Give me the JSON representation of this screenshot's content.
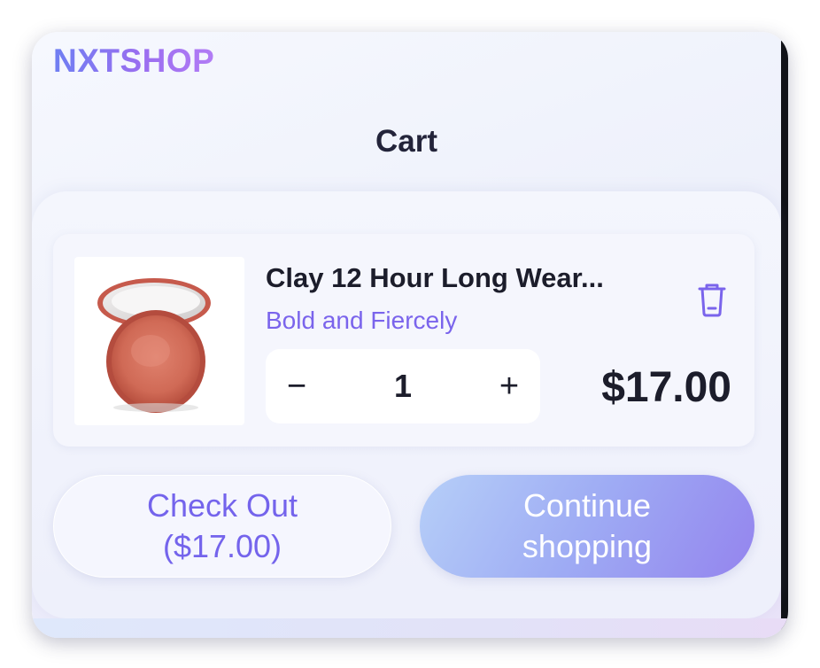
{
  "header": {
    "brand": "NXTSHOP",
    "title": "Cart"
  },
  "cart": {
    "items": [
      {
        "name": "Clay 12 Hour Long Wear...",
        "variant": "Bold and Fiercely",
        "quantity": "1",
        "price": "$17.00",
        "decrease_symbol": "−",
        "increase_symbol": "+"
      }
    ]
  },
  "actions": {
    "checkout_line1": "Check Out",
    "checkout_line2": "($17.00)",
    "continue_line1": "Continue",
    "continue_line2": "shopping"
  },
  "colors": {
    "accent": "#7a64ec",
    "text_dark": "#1c1d2b",
    "brand_gradient_start": "#6f7ff2",
    "brand_gradient_end": "#b27cf5"
  },
  "icons": {
    "delete": "trash-icon",
    "product": "blush-compact-image"
  }
}
